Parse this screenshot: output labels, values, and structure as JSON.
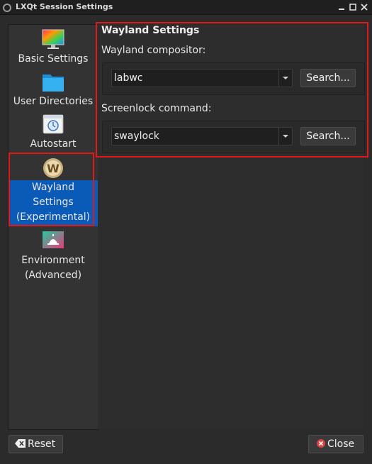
{
  "window": {
    "title": "LXQt Session Settings"
  },
  "sidebar": {
    "items": [
      {
        "lines": [
          "Basic Settings"
        ]
      },
      {
        "lines": [
          "User Directories"
        ]
      },
      {
        "lines": [
          "Autostart"
        ]
      },
      {
        "lines": [
          "Wayland",
          "Settings",
          "(Experimental)"
        ],
        "active": true
      },
      {
        "lines": [
          "Environment",
          "(Advanced)"
        ]
      }
    ]
  },
  "main": {
    "section_title": "Wayland Settings",
    "compositor": {
      "label": "Wayland compositor:",
      "value": "labwc",
      "search_label": "Search..."
    },
    "screenlock": {
      "label": "Screenlock command:",
      "value": "swaylock",
      "search_label": "Search..."
    }
  },
  "footer": {
    "reset_label": "Reset",
    "close_label": "Close"
  },
  "colors": {
    "accent": "#0a5ab8",
    "highlight": "#e01a1a"
  }
}
